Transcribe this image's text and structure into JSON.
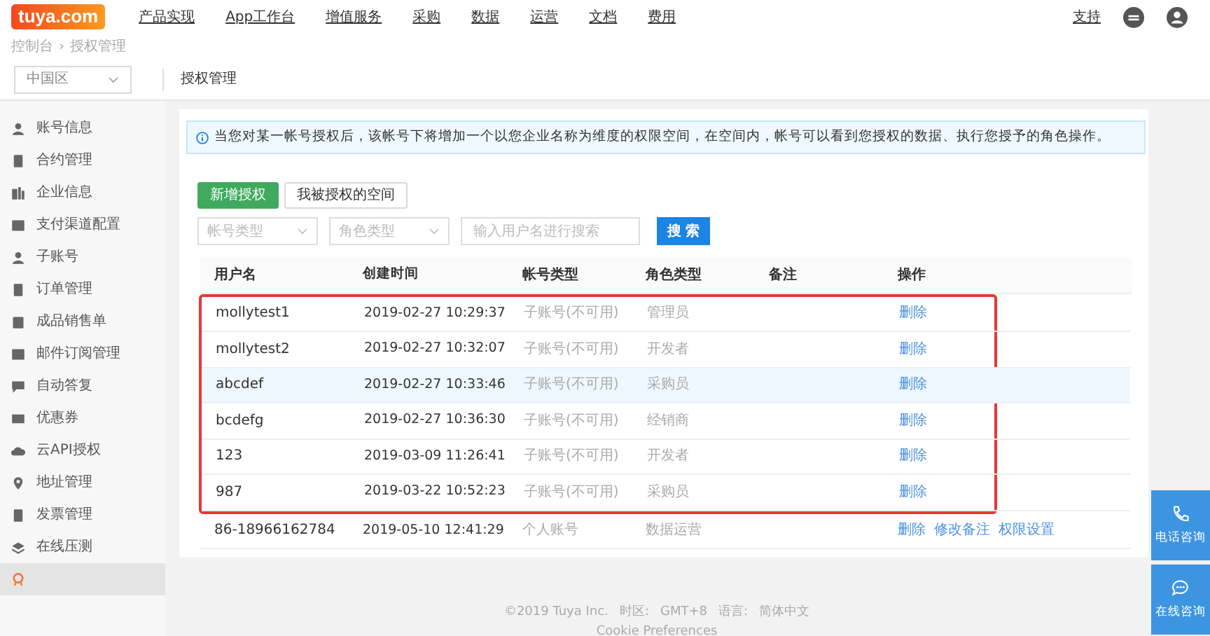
{
  "top_nav": {
    "logo": "tuya.com",
    "items": [
      "产品实现",
      "App工作台",
      "增值服务",
      "采购",
      "数据",
      "运营",
      "文档",
      "费用"
    ],
    "support": "支持"
  },
  "breadcrumb": {
    "items": [
      "控制台",
      "授权管理"
    ],
    "separator": "›"
  },
  "region_select": {
    "value": "中国区"
  },
  "page_title": "授权管理",
  "sidebar": {
    "items": [
      {
        "label": "账号信息",
        "selected": false
      },
      {
        "label": "合约管理",
        "selected": false
      },
      {
        "label": "企业信息",
        "selected": false
      },
      {
        "label": "支付渠道配置",
        "selected": false
      },
      {
        "label": "子账号",
        "selected": false
      },
      {
        "label": "订单管理",
        "selected": false
      },
      {
        "label": "成品销售单",
        "selected": false
      },
      {
        "label": "邮件订阅管理",
        "selected": false
      },
      {
        "label": "自动答复",
        "selected": false
      },
      {
        "label": "优惠券",
        "selected": false
      },
      {
        "label": "云API授权",
        "selected": false
      },
      {
        "label": "地址管理",
        "selected": false
      },
      {
        "label": "发票管理",
        "selected": false
      },
      {
        "label": "在线压测",
        "selected": false
      },
      {
        "selected": true
      }
    ]
  },
  "info_alert": "当您对某一帐号授权后，该帐号下将增加一个以您企业名称为维度的权限空间，在空间内，帐号可以看到您授权的数据、执行您授予的角色操作。",
  "tabs": [
    {
      "label": "新增授权",
      "selected": true
    },
    {
      "label": "我被授权的空间",
      "selected": false
    }
  ],
  "filters": {
    "account_type": {
      "placeholder": "帐号类型"
    },
    "role_type": {
      "placeholder": "角色类型"
    },
    "search": {
      "placeholder": "输入用户名进行搜索"
    },
    "search_button": "搜 索"
  },
  "table": {
    "columns": [
      "用户名",
      "创建时间",
      "帐号类型",
      "角色类型",
      "备注",
      "操作"
    ],
    "rows": [
      {
        "username": "mollytest1",
        "created": "2019-02-27 10:29:37",
        "account_type": "子账号(不可用)",
        "role": "管理员",
        "actions": [
          "删除"
        ],
        "hovered": false,
        "marked": true
      },
      {
        "username": "mollytest2",
        "created": "2019-02-27 10:32:07",
        "account_type": "子账号(不可用)",
        "role": "开发者",
        "actions": [
          "删除"
        ],
        "hovered": false,
        "marked": true
      },
      {
        "username": "abcdef",
        "created": "2019-02-27 10:33:46",
        "account_type": "子账号(不可用)",
        "role": "采购员",
        "actions": [
          "删除"
        ],
        "hovered": true,
        "marked": true
      },
      {
        "username": "bcdefg",
        "created": "2019-02-27 10:36:30",
        "account_type": "子账号(不可用)",
        "role": "经销商",
        "actions": [
          "删除"
        ],
        "hovered": false,
        "marked": true
      },
      {
        "username": "123",
        "created": "2019-03-09 11:26:41",
        "account_type": "子账号(不可用)",
        "role": "开发者",
        "actions": [
          "删除"
        ],
        "hovered": false,
        "marked": true
      },
      {
        "username": "987",
        "created": "2019-03-22 10:52:23",
        "account_type": "子账号(不可用)",
        "role": "采购员",
        "actions": [
          "删除"
        ],
        "hovered": false,
        "marked": true
      },
      {
        "username": "86-18966162784",
        "created": "2019-05-10 12:41:29",
        "account_type": "个人账号",
        "role": "数据运营",
        "actions": [
          "删除",
          "修改备注",
          "权限设置"
        ],
        "hovered": false,
        "marked": false
      }
    ]
  },
  "footer": {
    "copyright": "©2019 Tuya Inc.",
    "timezone_label": "时区:",
    "timezone": "GMT+8",
    "language_label": "语言:",
    "language": "简体中文",
    "cookie": "Cookie Preferences"
  },
  "float_buttons": [
    {
      "kind": "phone",
      "label": "电话咨询"
    },
    {
      "kind": "chat",
      "label": "在线咨询"
    }
  ]
}
